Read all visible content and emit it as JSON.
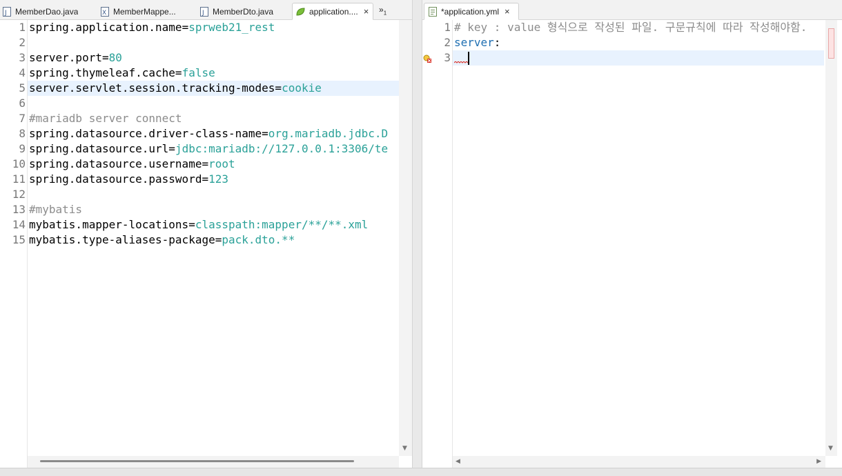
{
  "left_tabs": [
    {
      "label": "MemberDao.java",
      "icon": "java-file-icon",
      "active": false
    },
    {
      "label": "MemberMappe...",
      "icon": "xml-file-icon",
      "active": false
    },
    {
      "label": "MemberDto.java",
      "icon": "java-file-icon",
      "active": false
    },
    {
      "label": "application....",
      "icon": "spring-leaf-icon",
      "active": true,
      "close": "×"
    }
  ],
  "left_overflow": {
    "label": "»",
    "count": "1"
  },
  "right_tabs": [
    {
      "label": "*application.yml",
      "icon": "yaml-file-icon",
      "active": true,
      "close": "×"
    }
  ],
  "properties_editor": {
    "highlighted_line": 5,
    "lines": [
      {
        "num": "1",
        "key": "spring.application.name",
        "eq": "=",
        "val": "sprweb21_rest"
      },
      {
        "num": "2",
        "text": ""
      },
      {
        "num": "3",
        "key": "server.port",
        "eq": "=",
        "val": "80"
      },
      {
        "num": "4",
        "key": "spring.thymeleaf.cache",
        "eq": "=",
        "val": "false"
      },
      {
        "num": "5",
        "key": "server.servlet.session.tracking-modes",
        "eq": "=",
        "val": "cookie"
      },
      {
        "num": "6",
        "text": ""
      },
      {
        "num": "7",
        "comment": "#mariadb server connect"
      },
      {
        "num": "8",
        "key": "spring.datasource.driver-class-name",
        "eq": "=",
        "val": "org.mariadb.jdbc.D"
      },
      {
        "num": "9",
        "key": "spring.datasource.url",
        "eq": "=",
        "val": "jdbc:mariadb://127.0.0.1:3306/te"
      },
      {
        "num": "10",
        "key": "spring.datasource.username",
        "eq": "=",
        "val": "root"
      },
      {
        "num": "11",
        "key": "spring.datasource.password",
        "eq": "=",
        "val": "123"
      },
      {
        "num": "12",
        "text": ""
      },
      {
        "num": "13",
        "comment": "#mybatis"
      },
      {
        "num": "14",
        "key": "mybatis.mapper-locations",
        "eq": "=",
        "val": "classpath:mapper/**/**.xml"
      },
      {
        "num": "15",
        "key": "mybatis.type-aliases-package",
        "eq": "=",
        "val": "pack.dto.**"
      }
    ]
  },
  "yaml_editor": {
    "current_line": 3,
    "lines": [
      {
        "num": "1",
        "comment": "# key : value 형식으로 작성된 파일. 구문규칙에 따라 작성해야함."
      },
      {
        "num": "2",
        "ykey": "server",
        "colon": ":"
      },
      {
        "num": "3",
        "text": ""
      }
    ],
    "error_marker": "error-warning-icon"
  },
  "colors": {
    "value": "#2aa198",
    "comment": "#8c8c8c",
    "yaml_key": "#1f6fb2",
    "line_highlight": "#e8f2fe"
  }
}
